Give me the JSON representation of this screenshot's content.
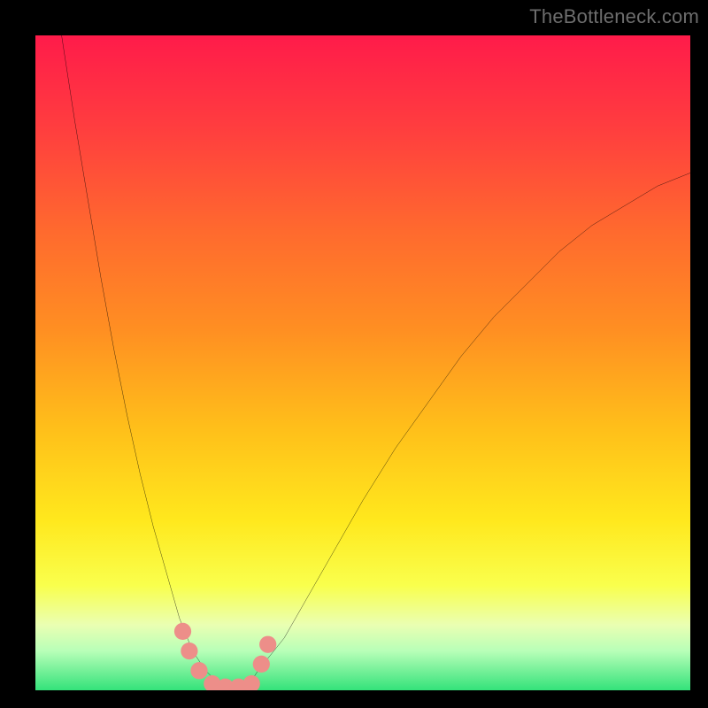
{
  "watermark": "TheBottleneck.com",
  "chart_data": {
    "type": "line",
    "title": "",
    "xlabel": "",
    "ylabel": "",
    "xlim": [
      0,
      100
    ],
    "ylim": [
      0,
      100
    ],
    "grid": false,
    "background_gradient": {
      "direction": "vertical",
      "stops": [
        {
          "pos": 0.0,
          "color": "#ff1b4a"
        },
        {
          "pos": 0.14,
          "color": "#ff3d3f"
        },
        {
          "pos": 0.3,
          "color": "#ff6a2e"
        },
        {
          "pos": 0.45,
          "color": "#ff8f22"
        },
        {
          "pos": 0.6,
          "color": "#ffbf1a"
        },
        {
          "pos": 0.74,
          "color": "#ffe81d"
        },
        {
          "pos": 0.84,
          "color": "#f9ff4d"
        },
        {
          "pos": 0.9,
          "color": "#eaffb2"
        },
        {
          "pos": 0.94,
          "color": "#b8ffb8"
        },
        {
          "pos": 1.0,
          "color": "#33e27a"
        }
      ]
    },
    "series": [
      {
        "name": "bottleneck-curve",
        "color": "#000000",
        "x": [
          4,
          6,
          8,
          10,
          12,
          14,
          16,
          18,
          20,
          22,
          24,
          26,
          28,
          30,
          32,
          34,
          38,
          42,
          46,
          50,
          55,
          60,
          65,
          70,
          75,
          80,
          85,
          90,
          95,
          100
        ],
        "values": [
          100,
          87,
          75,
          63,
          52,
          42,
          33,
          25,
          18,
          11,
          6,
          3,
          1,
          0,
          0,
          3,
          8,
          15,
          22,
          29,
          37,
          44,
          51,
          57,
          62,
          67,
          71,
          74,
          77,
          79
        ]
      }
    ],
    "markers": [
      {
        "name": "dot",
        "x": 22.5,
        "y": 9,
        "r": 1.3,
        "color": "#ed8e89"
      },
      {
        "name": "dot",
        "x": 23.5,
        "y": 6,
        "r": 1.3,
        "color": "#ed8e89"
      },
      {
        "name": "dot",
        "x": 25.0,
        "y": 3,
        "r": 1.3,
        "color": "#ed8e89"
      },
      {
        "name": "dot",
        "x": 27.0,
        "y": 1,
        "r": 1.3,
        "color": "#ed8e89"
      },
      {
        "name": "dot",
        "x": 29.0,
        "y": 0.5,
        "r": 1.3,
        "color": "#ed8e89"
      },
      {
        "name": "dot",
        "x": 31.0,
        "y": 0.5,
        "r": 1.3,
        "color": "#ed8e89"
      },
      {
        "name": "dot",
        "x": 33.0,
        "y": 1,
        "r": 1.3,
        "color": "#ed8e89"
      },
      {
        "name": "dot",
        "x": 34.5,
        "y": 4,
        "r": 1.3,
        "color": "#ed8e89"
      },
      {
        "name": "dot",
        "x": 35.5,
        "y": 7,
        "r": 1.3,
        "color": "#ed8e89"
      }
    ]
  }
}
